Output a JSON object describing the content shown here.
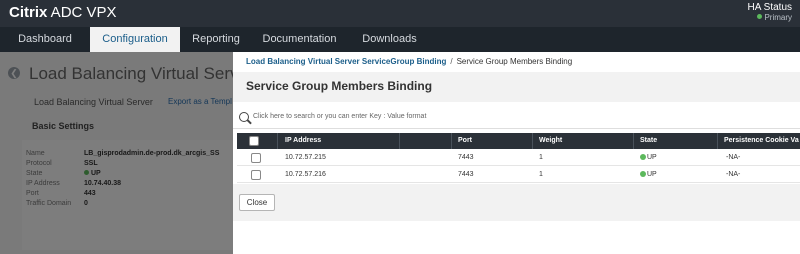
{
  "app": {
    "brand_bold": "Citrix",
    "brand_rest": " ADC VPX",
    "ha_title": "HA Status",
    "ha_status": "Primary",
    "status_color": "#5cb85c"
  },
  "nav": {
    "items": [
      "Dashboard",
      "Configuration",
      "Reporting",
      "Documentation",
      "Downloads"
    ],
    "active": "Configuration"
  },
  "background": {
    "title": "Load Balancing Virtual Serve",
    "subtitle": "Load Balancing Virtual Server",
    "export_link": "Export as a Templ",
    "section": "Basic Settings",
    "fields": [
      {
        "key": "Name",
        "value": "LB_gisprodadmin.de-prod.dk_arcgis_SS"
      },
      {
        "key": "Protocol",
        "value": "SSL"
      },
      {
        "key": "State",
        "value": "UP"
      },
      {
        "key": "IP Address",
        "value": "10.74.40.38"
      },
      {
        "key": "Port",
        "value": "443"
      },
      {
        "key": "Traffic Domain",
        "value": "0"
      }
    ]
  },
  "panel": {
    "breadcrumb_link": "Load Balancing Virtual Server ServiceGroup Binding",
    "breadcrumb_sep": "/",
    "breadcrumb_current": "Service Group Members Binding",
    "title": "Service Group Members Binding",
    "search_placeholder": "Click here to search or you can enter Key : Value format",
    "columns": [
      "IP Address",
      "Port",
      "Weight",
      "State",
      "Persistence Cookie Va"
    ],
    "rows": [
      {
        "ip": "10.72.57.215",
        "port": "7443",
        "weight": "1",
        "state": "UP",
        "cookie": "-NA-"
      },
      {
        "ip": "10.72.57.216",
        "port": "7443",
        "weight": "1",
        "state": "UP",
        "cookie": "-NA-"
      }
    ],
    "close_label": "Close"
  }
}
